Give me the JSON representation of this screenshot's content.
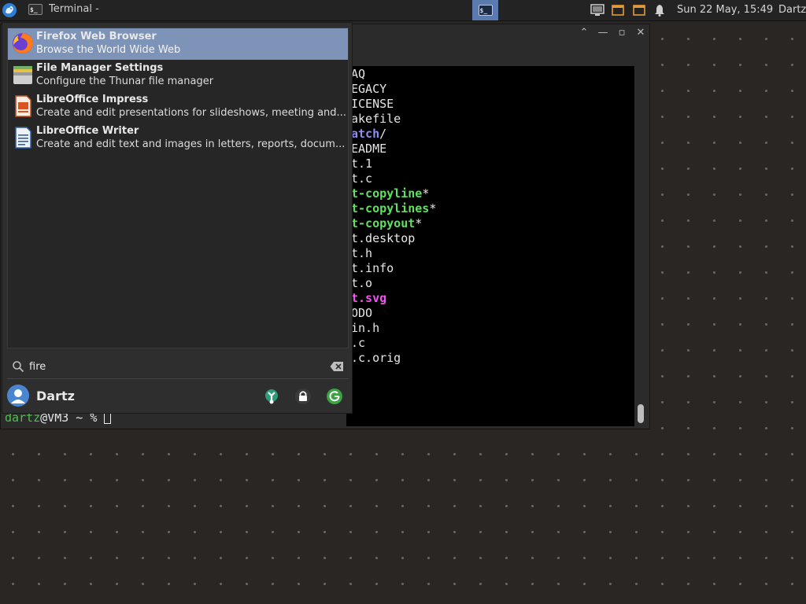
{
  "top_panel": {
    "window_title": "Terminal -",
    "clock": "Sun 22 May, 15:49",
    "user": "Dartz",
    "icons": [
      "whisker-menu-icon",
      "terminal-icon",
      "network-icon",
      "notes-icon",
      "notes-icon",
      "notification-bell-icon"
    ],
    "accent": "#5b7ab0"
  },
  "terminal": {
    "lines": [
      {
        "text": "AQ",
        "cls": ""
      },
      {
        "text": "EGACY",
        "cls": ""
      },
      {
        "text": "ICENSE",
        "cls": ""
      },
      {
        "text": "akefile",
        "cls": ""
      },
      {
        "text": "atch",
        "cls": "c-blue",
        "suffix": "/"
      },
      {
        "text": "EADME",
        "cls": ""
      },
      {
        "text": "t.1",
        "cls": ""
      },
      {
        "text": "t.c",
        "cls": ""
      },
      {
        "text": "t-copyline",
        "cls": "c-green",
        "suffix": "*"
      },
      {
        "text": "t-copylines",
        "cls": "c-green",
        "suffix": "*"
      },
      {
        "text": "t-copyout",
        "cls": "c-green",
        "suffix": "*"
      },
      {
        "text": "t.desktop",
        "cls": ""
      },
      {
        "text": "t.h",
        "cls": ""
      },
      {
        "text": "t.info",
        "cls": ""
      },
      {
        "text": "t.o",
        "cls": ""
      },
      {
        "text": "t.svg",
        "cls": "c-magenta"
      },
      {
        "text": "ODO",
        "cls": ""
      },
      {
        "text": "in.h",
        "cls": ""
      },
      {
        "text": ".c",
        "cls": ""
      },
      {
        "text": ".c.orig",
        "cls": ""
      }
    ],
    "prompt_user": "dartz",
    "prompt_rest": "@VM3 ~ % "
  },
  "whisker": {
    "results": [
      {
        "name": "Firefox Web Browser",
        "desc": "Browse the World Wide Web",
        "icon": "firefox-icon",
        "selected": true
      },
      {
        "name": "File Manager Settings",
        "desc": "Configure the Thunar file manager",
        "icon": "file-manager-settings-icon",
        "selected": false
      },
      {
        "name": "LibreOffice Impress",
        "desc": "Create and edit presentations for slideshows, meeting and...",
        "icon": "libreoffice-impress-icon",
        "selected": false
      },
      {
        "name": "LibreOffice Writer",
        "desc": "Create and edit text and images in letters, reports, docum...",
        "icon": "libreoffice-writer-icon",
        "selected": false
      }
    ],
    "search_value": "fire",
    "user_name": "Dartz",
    "selected_color": "#7d93b8"
  }
}
